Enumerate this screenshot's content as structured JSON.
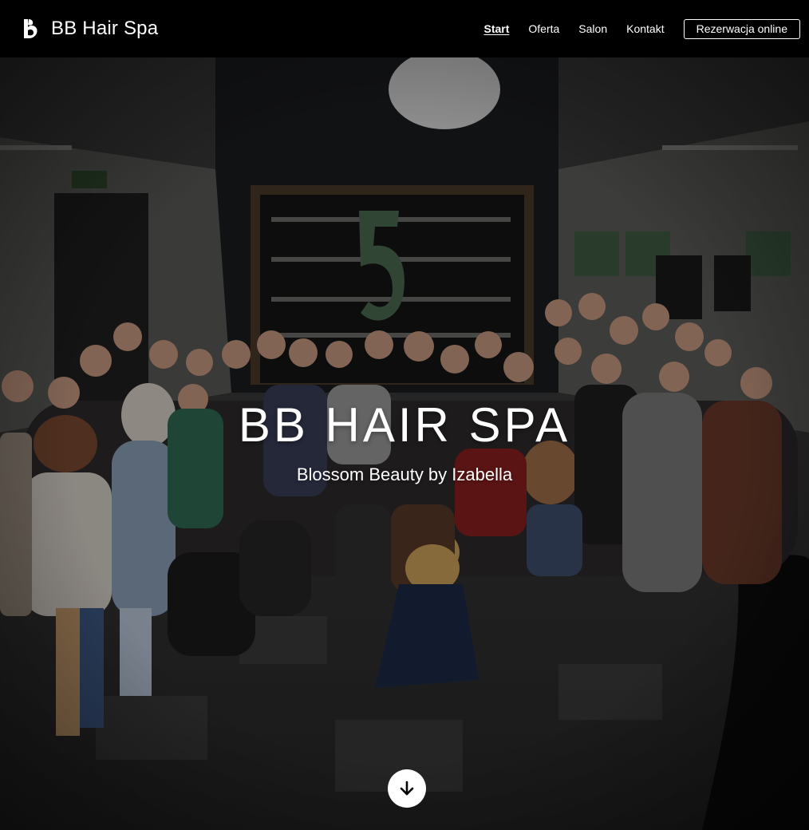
{
  "header": {
    "brand_name": "BB Hair Spa",
    "brand_icon": "bb-logo-icon",
    "nav": [
      {
        "label": "Start",
        "active": true
      },
      {
        "label": "Oferta",
        "active": false
      },
      {
        "label": "Salon",
        "active": false
      },
      {
        "label": "Kontakt",
        "active": false
      }
    ],
    "cta_label": "Rezerwacja online"
  },
  "hero": {
    "title": "BB HAIR SPA",
    "subtitle": "Blossom Beauty by Izabella",
    "scroll_icon": "arrow-down-icon",
    "background": "group-photo"
  },
  "colors": {
    "header_bg": "#000000",
    "text": "#ffffff",
    "button_bg": "#ffffff",
    "button_icon": "#000000"
  }
}
